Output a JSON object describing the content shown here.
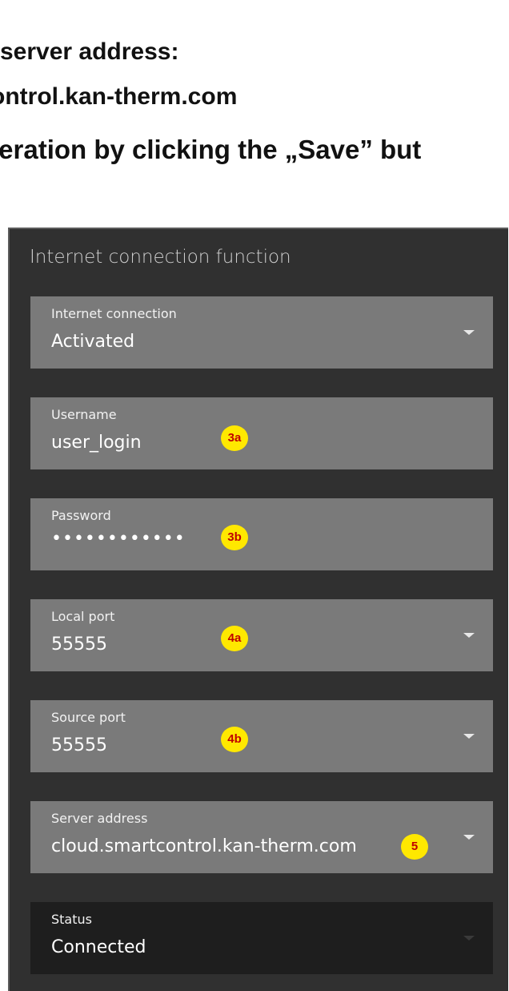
{
  "instructions": {
    "line1": " server address:",
    "line2": "ontrol.kan-therm.com",
    "line3": "peration by clicking the „Save” but"
  },
  "panel": {
    "title": "Internet connection function",
    "fields": [
      {
        "label": "Internet connection",
        "value": "Activated",
        "badge": ""
      },
      {
        "label": "Username",
        "value": "user_login",
        "badge": "3a"
      },
      {
        "label": "Password",
        "value": "••••••••••••",
        "badge": "3b"
      },
      {
        "label": "Local port",
        "value": "55555",
        "badge": "4a"
      },
      {
        "label": "Source port",
        "value": "55555",
        "badge": "4b"
      },
      {
        "label": "Server address",
        "value": "cloud.smartcontrol.kan-therm.com",
        "badge": "5"
      },
      {
        "label": "Status",
        "value": "Connected",
        "badge": ""
      }
    ]
  },
  "icons": {
    "dropdown": "chevron-down-icon"
  },
  "colors": {
    "panel_background": "#303030",
    "field_background": "#7a7a7a",
    "status_background": "#1e1e1e",
    "badge_fill": "#ffe800",
    "badge_text": "#c00000"
  }
}
